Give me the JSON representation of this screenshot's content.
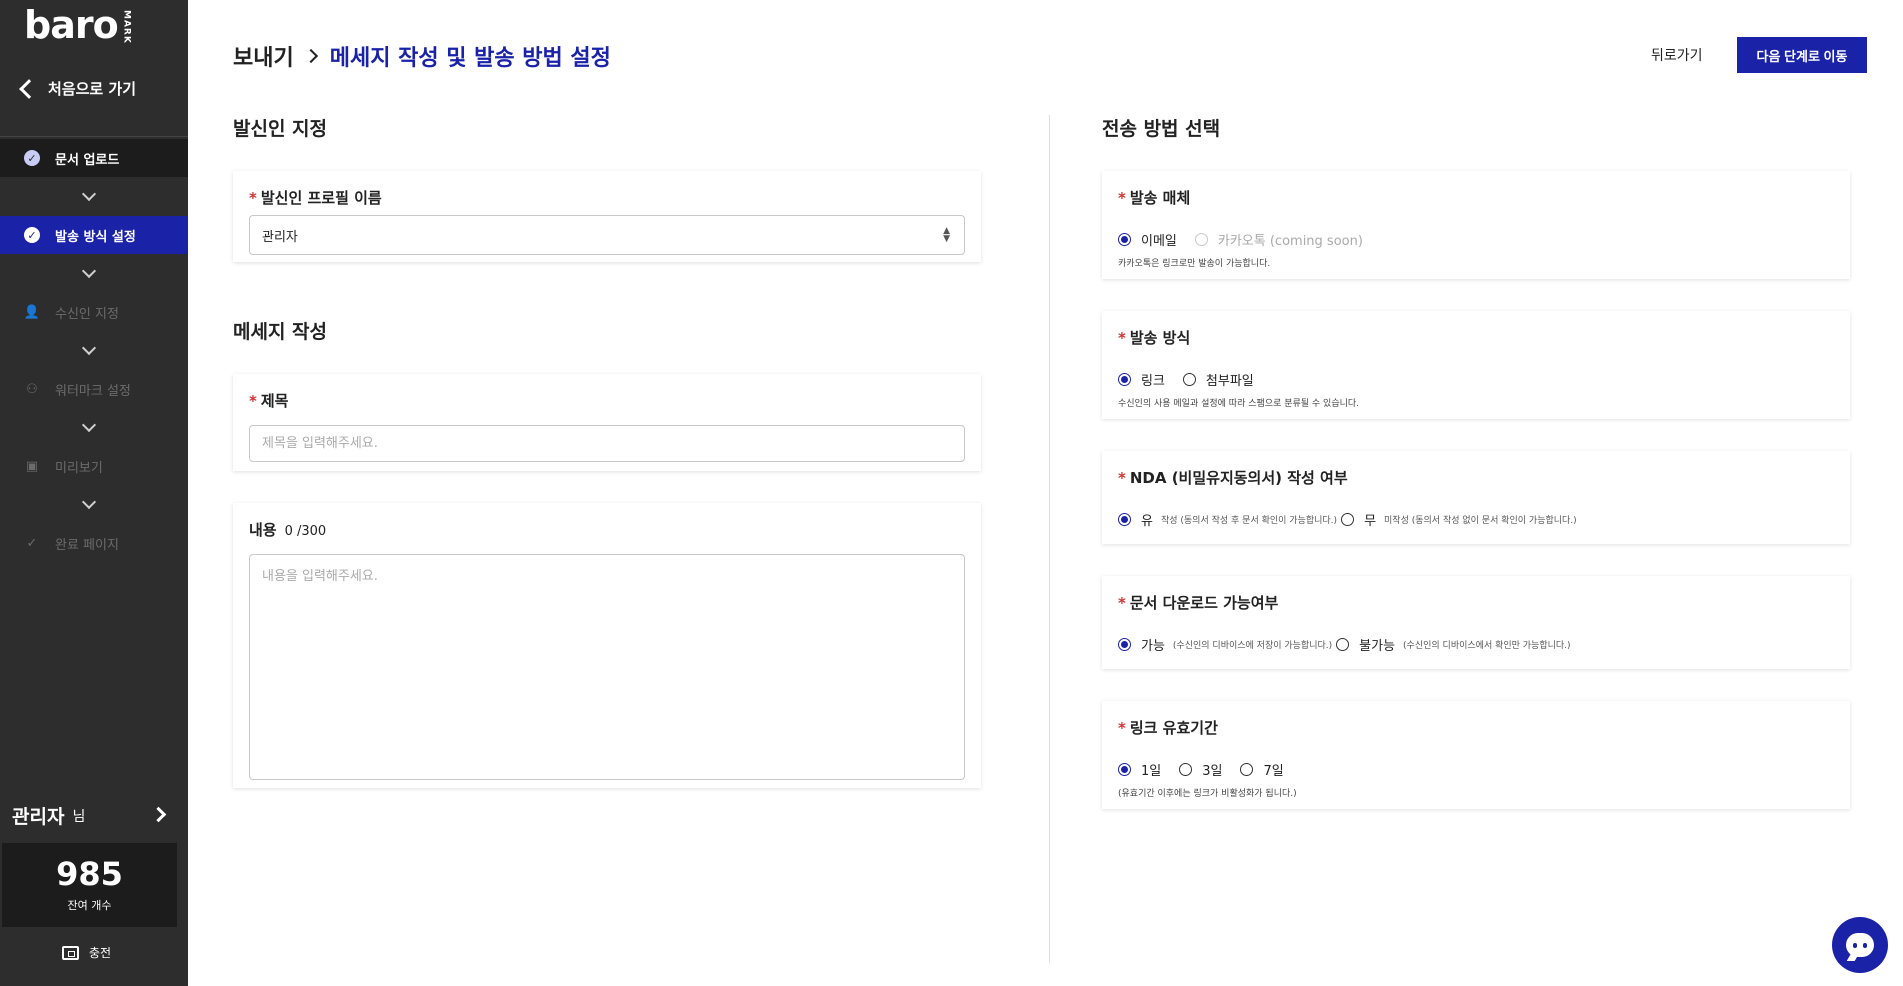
{
  "sidebar": {
    "logo_text": "baro",
    "logo_sub": "MARK",
    "back_label": "처음으로 가기",
    "steps": [
      {
        "label": "문서 업로드",
        "state": "done",
        "icon": "check-circle-icon"
      },
      {
        "label": "발송 방식 설정",
        "state": "active",
        "icon": "check-circle-icon"
      },
      {
        "label": "수신인 지정",
        "state": "disabled",
        "icon": "user-add-icon"
      },
      {
        "label": "워터마크 설정",
        "state": "disabled",
        "icon": "user-lock-icon"
      },
      {
        "label": "미리보기",
        "state": "disabled",
        "icon": "preview-icon"
      },
      {
        "label": "완료 페이지",
        "state": "disabled",
        "icon": "check-icon"
      }
    ],
    "user_name": "관리자",
    "user_suffix": "님",
    "count": "985",
    "count_label": "잔여 개수",
    "charge_label": "충전"
  },
  "header": {
    "breadcrumb_root": "보내기",
    "breadcrumb_current": "메세지 작성 및 발송 방법 설정",
    "back_button": "뒤로가기",
    "next_button": "다음 단계로 이동"
  },
  "sender": {
    "section_title": "발신인 지정",
    "profile_label": "발신인 프로필 이름",
    "profile_value": "관리자"
  },
  "message": {
    "section_title": "메세지 작성",
    "subject_label": "제목",
    "subject_placeholder": "제목을 입력해주세요.",
    "content_label": "내용",
    "content_count": "0 /300",
    "content_placeholder": "내용을 입력해주세요."
  },
  "delivery": {
    "section_title": "전송 방법 선택",
    "medium": {
      "label": "발송 매체",
      "options": [
        "이메일",
        "카카오톡 (coming soon)"
      ],
      "selected": "이메일",
      "help": "카카오톡은 링크로만 발송이 가능합니다."
    },
    "method": {
      "label": "발송 방식",
      "options": [
        "링크",
        "첨부파일"
      ],
      "selected": "링크",
      "help": "수신인의 사용 메일과 설정에 따라 스팸으로 분류될 수 있습니다."
    },
    "nda": {
      "label": "NDA (비밀유지동의서) 작성 여부",
      "options": [
        "유",
        "무"
      ],
      "notes": [
        "작성 (동의서 작성 후 문서 확인이 가능합니다.)",
        "미작성 (동의서 작성 없이 문서 확인이 가능합니다.)"
      ],
      "selected": "유"
    },
    "download": {
      "label": "문서 다운로드 가능여부",
      "options": [
        "가능",
        "불가능"
      ],
      "notes": [
        "(수신인의 디바이스에 저장이 가능합니다.)",
        "(수신인의 디바이스에서 확인만 가능합니다.)"
      ],
      "selected": "가능"
    },
    "expiry": {
      "label": "링크 유효기간",
      "options": [
        "1일",
        "3일",
        "7일"
      ],
      "selected": "1일",
      "help": "(유효기간 이후에는 링크가 비활성화가 됩니다.)"
    }
  },
  "colors": {
    "sidebar_bg": "#2d2d2d",
    "accent": "#1a22a8",
    "required": "#d23232"
  }
}
